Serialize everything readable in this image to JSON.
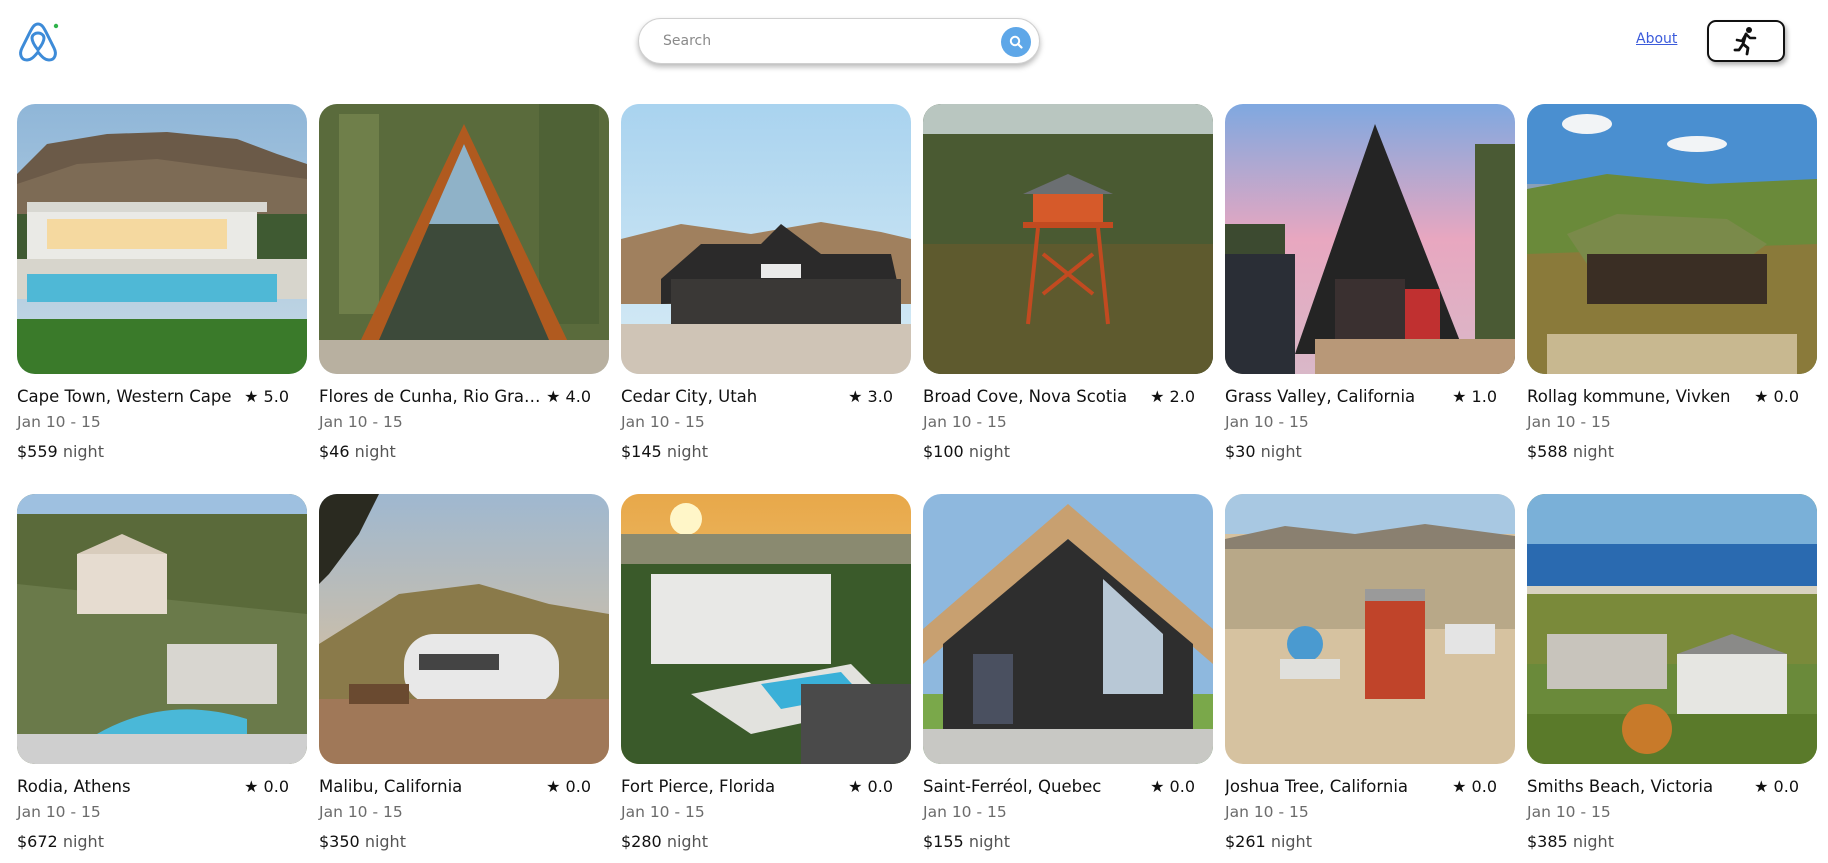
{
  "header": {
    "search": {
      "placeholder": "Search"
    },
    "about_label": "About"
  },
  "colors": {
    "accent": "#5ea7e8",
    "logo": "#3d8bd8",
    "link": "#3b5bdb"
  },
  "listings": [
    {
      "location": "Cape Town, Western Cape",
      "rating": "★ 5.0",
      "dates": "Jan 10 - 15",
      "price": "$559",
      "unit": "night",
      "scene": "villa-pool"
    },
    {
      "location": "Flores de Cunha, Rio Grand...",
      "rating": "★ 4.0",
      "dates": "Jan 10 - 15",
      "price": "$46",
      "unit": "night",
      "scene": "a-frame-forest"
    },
    {
      "location": "Cedar City, Utah",
      "rating": "★ 3.0",
      "dates": "Jan 10 - 15",
      "price": "$145",
      "unit": "night",
      "scene": "dark-house-desert"
    },
    {
      "location": "Broad Cove, Nova Scotia",
      "rating": "★ 2.0",
      "dates": "Jan 10 - 15",
      "price": "$100",
      "unit": "night",
      "scene": "fire-tower"
    },
    {
      "location": "Grass Valley, California",
      "rating": "★ 1.0",
      "dates": "Jan 10 - 15",
      "price": "$30",
      "unit": "night",
      "scene": "a-frame-dusk"
    },
    {
      "location": "Rollag kommune, Vivken",
      "rating": "★ 0.0",
      "dates": "Jan 10 - 15",
      "price": "$588",
      "unit": "night",
      "scene": "sod-roof-cabin"
    },
    {
      "location": "Rodia, Athens",
      "rating": "★ 0.0",
      "dates": "Jan 10 - 15",
      "price": "$672",
      "unit": "night",
      "scene": "hillside-villa"
    },
    {
      "location": "Malibu, California",
      "rating": "★ 0.0",
      "dates": "Jan 10 - 15",
      "price": "$350",
      "unit": "night",
      "scene": "airstream"
    },
    {
      "location": "Fort Pierce, Florida",
      "rating": "★ 0.0",
      "dates": "Jan 10 - 15",
      "price": "$280",
      "unit": "night",
      "scene": "sunset-mansion"
    },
    {
      "location": "Saint-Ferréol, Quebec",
      "rating": "★ 0.0",
      "dates": "Jan 10 - 15",
      "price": "$155",
      "unit": "night",
      "scene": "modern-gable"
    },
    {
      "location": "Joshua Tree, California",
      "rating": "★ 0.0",
      "dates": "Jan 10 - 15",
      "price": "$261",
      "unit": "night",
      "scene": "container-house"
    },
    {
      "location": "Smiths Beach, Victoria",
      "rating": "★ 0.0",
      "dates": "Jan 10 - 15",
      "price": "$385",
      "unit": "night",
      "scene": "coastal-house"
    }
  ]
}
